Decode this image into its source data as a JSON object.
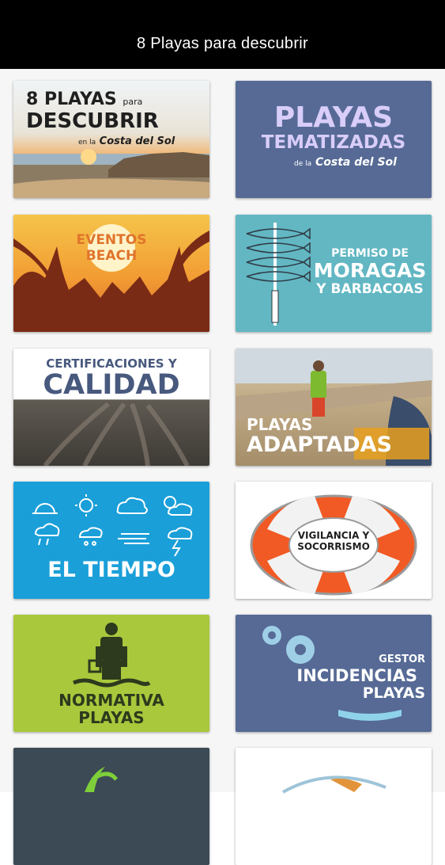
{
  "header": {
    "title": "8 Playas para descubrir"
  },
  "tiles": [
    {
      "l1": "8 PLAYAS",
      "l1b": "para",
      "l2": "DESCUBRIR",
      "l3": "en la",
      "l3b": "Costa del Sol"
    },
    {
      "l1": "PLAYAS",
      "l2": "TEMATIZADAS",
      "l3": "de la",
      "l3b": "Costa del Sol"
    },
    {
      "l1": "EVENTOS",
      "l2": "BEACH"
    },
    {
      "l1": "PERMISO DE",
      "l2": "MORAGAS",
      "l3": "Y BARBACOAS"
    },
    {
      "l1": "CERTIFICACIONES Y",
      "l2": "CALIDAD"
    },
    {
      "l1": "PLAYAS",
      "l2": "ADAPTADAS"
    },
    {
      "l1": "EL TIEMPO"
    },
    {
      "l1": "VIGILANCIA Y",
      "l2": "SOCORRISMO"
    },
    {
      "l1": "NORMATIVA",
      "l2": "PLAYAS"
    },
    {
      "l1": "GESTOR",
      "l2": "INCIDENCIAS",
      "l3": "PLAYAS"
    }
  ],
  "colors": {
    "header_bg": "#000000",
    "blue_tile": "#566a95",
    "teal_tile": "#62b7c3",
    "sky_tile": "#1a9fd9",
    "lime_tile": "#a9c83c"
  }
}
